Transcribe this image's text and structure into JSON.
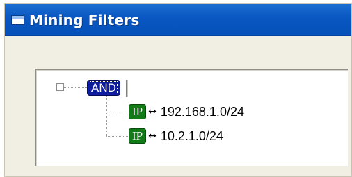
{
  "window": {
    "title": "Mining Filters",
    "icon": "window-icon"
  },
  "tree": {
    "root": {
      "label": "AND",
      "expanded": true,
      "expander_icon": "minus-box-icon"
    },
    "children": [
      {
        "badge": "IP",
        "relation_icon": "left-right-arrow-icon",
        "relation_symbol": "↔",
        "value": "192.168.1.0/24"
      },
      {
        "badge": "IP",
        "relation_icon": "left-right-arrow-icon",
        "relation_symbol": "↔",
        "value": "10.2.1.0/24"
      }
    ]
  },
  "colors": {
    "titlebar": "#0550b9",
    "and_node": "#0e1d9e",
    "ip_badge": "#137a18",
    "panel_bg": "#f1efe4"
  }
}
